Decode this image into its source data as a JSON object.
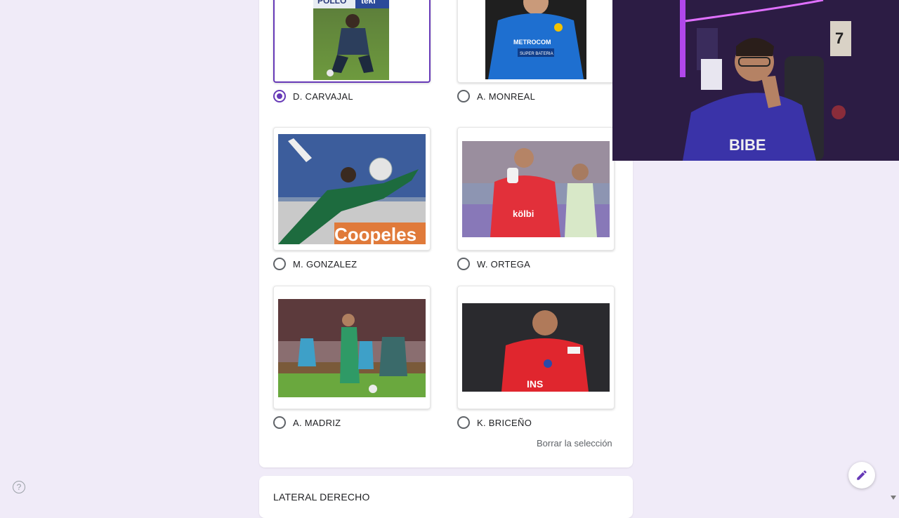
{
  "options": [
    {
      "label": "D. CARVAJAL",
      "selected": true
    },
    {
      "label": "A. MONREAL",
      "selected": false
    },
    {
      "label": "M. GONZALEZ",
      "selected": false
    },
    {
      "label": "W. ORTEGA",
      "selected": false
    },
    {
      "label": "A. MADRIZ",
      "selected": false
    },
    {
      "label": "K. BRICEÑO",
      "selected": false
    }
  ],
  "photo_text": {
    "carvajal_sponsor_1": "POLLO",
    "carvajal_sponsor_2": "teki",
    "monreal_sponsor_1": "METROCOM",
    "monreal_sponsor_2": "SUPER BATERIA",
    "gonzalez_ad": "Coopeles",
    "ortega_sponsor": "kölbi",
    "briceno_sponsor": "INS"
  },
  "clear_selection_label": "Borrar la selección",
  "next_section_title": "LATERAL DERECHO",
  "help_glyph": "?",
  "webcam_text": {
    "jersey_text": "BIBE",
    "poster_number": "7"
  },
  "icons": {
    "help": "help-circle-icon",
    "edit": "pencil-icon",
    "scroll": "scroll-down-arrow-icon"
  },
  "colors": {
    "accent": "#673ab7",
    "background": "#f0ebf8"
  }
}
